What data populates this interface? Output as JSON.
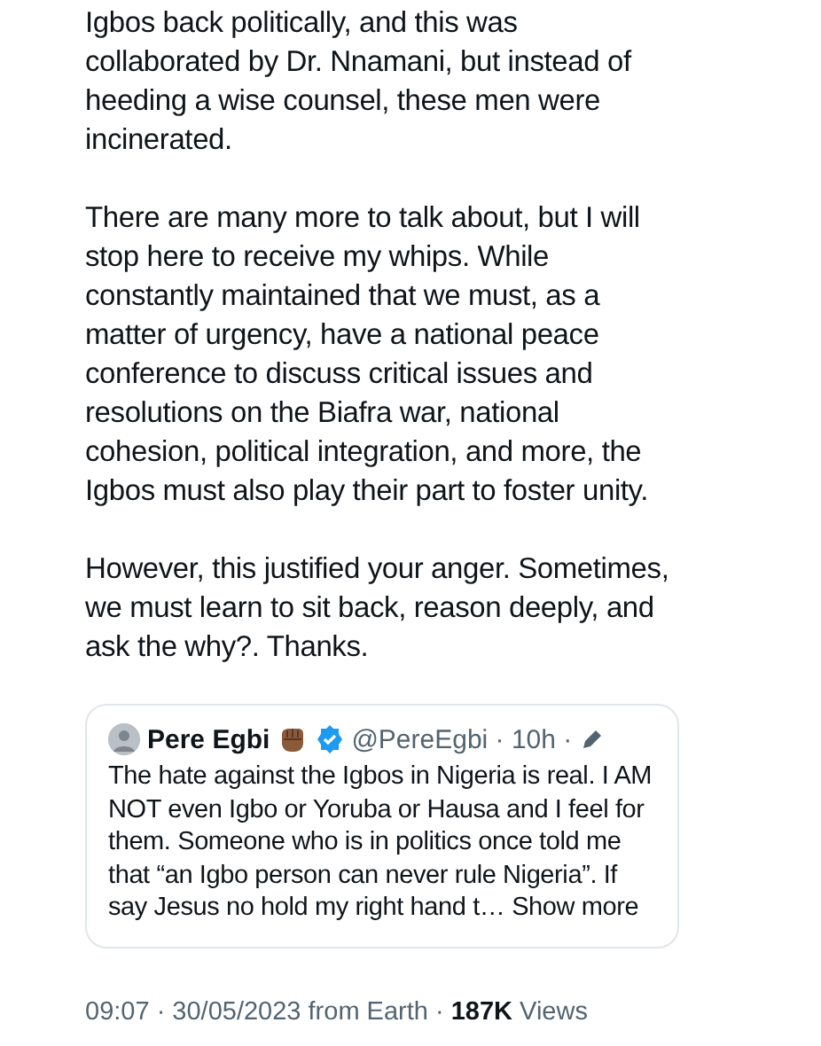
{
  "paragraphs": [
    "Igbos back politically, and this was collaborated by Dr. Nnamani, but instead of heeding a wise counsel, these men were incinerated.",
    "There are many more to talk about, but I will stop here to receive my whips. While constantly maintained that we must, as a matter of urgency, have a national peace conference to discuss critical issues and resolutions on the Biafra war, national cohesion, political integration, and more, the Igbos must also play their part to foster unity.",
    "However, this justified your anger. Sometimes, we must learn to sit back, reason deeply, and ask the why?. Thanks."
  ],
  "quote": {
    "name": "Pere Egbi",
    "verified": true,
    "handle": "@PereEgbi · 10h ·",
    "text": "The hate against the Igbos in Nigeria is real. I AM NOT even Igbo or Yoruba or Hausa and I feel for them. Someone who is in politics once told me that “an Igbo person can never rule Nigeria”. If say Jesus no hold my right hand t…",
    "more": "Show more"
  },
  "meta": "09:07 · 30/05/2023 from Earth · **187K** Views"
}
